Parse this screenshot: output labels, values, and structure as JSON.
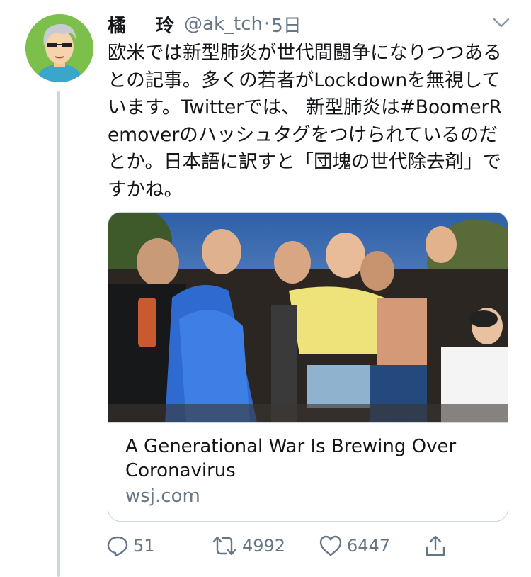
{
  "user": {
    "name": "橘　玲",
    "handle": "@ak_tch",
    "separator": "·",
    "time": "5日"
  },
  "tweet": {
    "text": "欧米では新型肺炎が世代間闘争になりつつあるとの記事。多くの若者がLockdownを無視しています。Twitterでは、 新型肺炎は#BoomerRemoverのハッシュタグをつけられているのだとか。日本語に訳すと「団塊の世代除去剤」ですかね。"
  },
  "card": {
    "title": "A Generational War Is Brewing Over Coronavirus",
    "domain": "wsj.com"
  },
  "actions": {
    "reply_count": "51",
    "retweet_count": "4992",
    "like_count": "6447"
  },
  "icons": [
    "avatar-image",
    "chevron-down-icon",
    "reply-icon",
    "retweet-icon",
    "like-icon",
    "share-icon"
  ],
  "colors": {
    "text": "#14171a",
    "secondary": "#657786",
    "border": "#ccd6dd",
    "avatar_bg": "#7cbf4a"
  }
}
